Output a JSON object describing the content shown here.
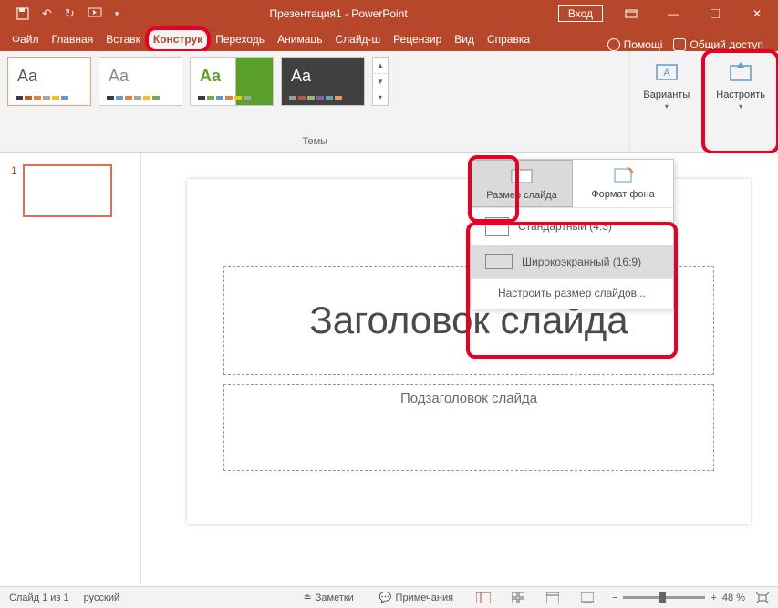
{
  "titlebar": {
    "doc_title": "Презентация1 - PowerPoint",
    "signin": "Вход"
  },
  "tabs": {
    "file": "Файл",
    "home": "Главная",
    "insert": "Вставк",
    "design": "Конструк",
    "transitions": "Переходь",
    "animations": "Анимаць",
    "slideshow": "Слайд-ш",
    "review": "Рецензир",
    "view": "Вид",
    "help": "Справка",
    "tell_me": "Помощі",
    "share": "Общий доступ"
  },
  "ribbon": {
    "themes_label": "Темы",
    "variants_label": "Варианты",
    "customize_label": "Настроить"
  },
  "sizepanel": {
    "slide_size": "Размер слайда",
    "format_bg": "Формат фона",
    "standard": "Стандартный (4:3)",
    "widescreen": "Широкоэкранный (16:9)",
    "custom": "Настроить размер слайдов..."
  },
  "slide": {
    "title_placeholder": "Заголовок слайда",
    "subtitle_placeholder": "Подзаголовок слайда",
    "thumb_num": "1"
  },
  "status": {
    "slide_of": "Слайд 1 из 1",
    "lang": "русский",
    "notes": "Заметки",
    "comments": "Примечания",
    "zoom": "48 %"
  }
}
